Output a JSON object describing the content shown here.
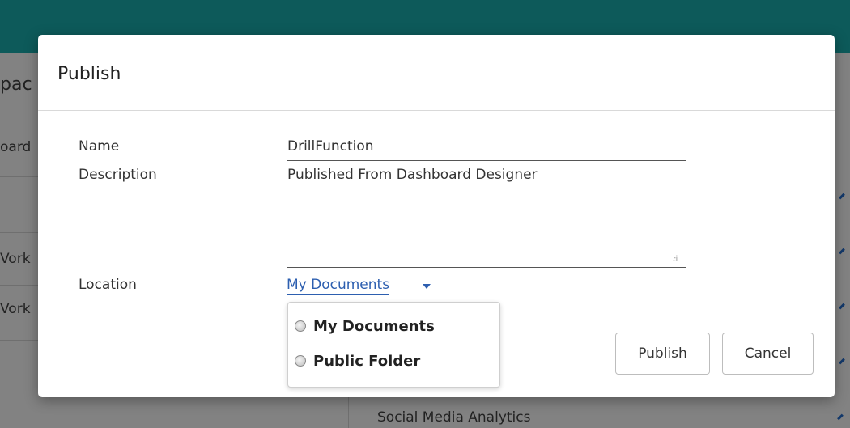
{
  "background": {
    "left_labels": [
      "pac",
      "oard",
      "Vork",
      "Vork"
    ],
    "bottom_row_text": "Social Media Analytics"
  },
  "modal": {
    "title": "Publish",
    "fields": {
      "name_label": "Name",
      "name_value": "DrillFunction",
      "description_label": "Description",
      "description_value": "Published From Dashboard Designer",
      "location_label": "Location",
      "location_value": "My Documents"
    },
    "buttons": {
      "publish": "Publish",
      "cancel": "Cancel"
    }
  },
  "location_dropdown": {
    "options": [
      {
        "label": "My Documents",
        "selected": false
      },
      {
        "label": "Public Folder",
        "selected": false
      }
    ]
  }
}
